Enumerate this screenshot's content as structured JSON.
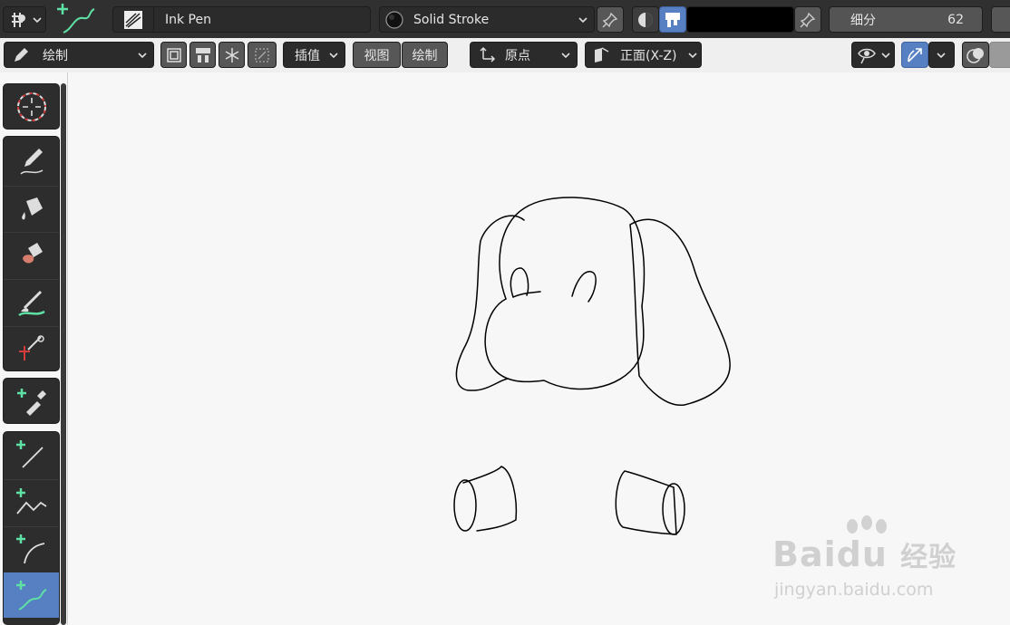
{
  "header": {
    "brush_name": "Ink Pen",
    "material_name": "Solid Stroke",
    "subdivision_label": "细分",
    "subdivision_value": "62"
  },
  "toolbar": {
    "mode_label": "绘制",
    "interpolate_label": "插值",
    "view_label": "视图",
    "draw_label": "绘制",
    "origin_label": "原点",
    "plane_label": "正面(X-Z)"
  },
  "tools": [
    {
      "name": "cursor"
    },
    {
      "name": "draw"
    },
    {
      "name": "fill"
    },
    {
      "name": "erase"
    },
    {
      "name": "tint"
    },
    {
      "name": "cutter"
    },
    {
      "name": "eyedropper"
    },
    {
      "name": "line"
    },
    {
      "name": "polyline"
    },
    {
      "name": "arc"
    },
    {
      "name": "curve",
      "active": true
    }
  ],
  "colors": {
    "accent": "#5680c2",
    "header_bg": "#303030",
    "canvas_bg": "#f7f7f7",
    "tool_plus": "#5fe0a4"
  },
  "watermark": {
    "brand": "Baidu",
    "suffix": "经验",
    "url": "jingyan.baidu.com"
  }
}
